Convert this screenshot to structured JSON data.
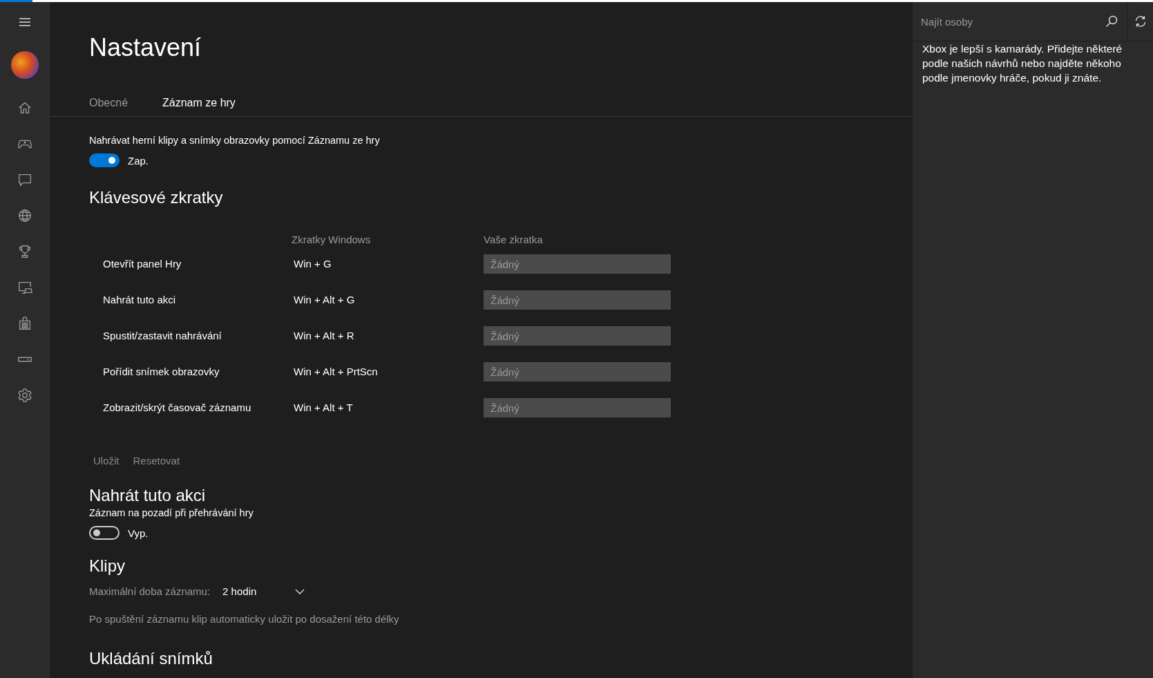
{
  "sidebar": {
    "items": [
      {
        "kind": "menu"
      },
      {
        "kind": "avatar"
      },
      {
        "kind": "home"
      },
      {
        "kind": "controller"
      },
      {
        "kind": "chat"
      },
      {
        "kind": "globe"
      },
      {
        "kind": "trophy"
      },
      {
        "kind": "screen"
      },
      {
        "kind": "store"
      },
      {
        "kind": "device"
      },
      {
        "kind": "settings"
      }
    ]
  },
  "title": "Nastavení",
  "tabs": [
    {
      "label": "Obecné",
      "selected": false
    },
    {
      "label": "Záznam ze hry",
      "selected": true
    }
  ],
  "record_setting": {
    "label": "Nahrávat herní klipy a snímky obrazovky pomocí Záznamu ze hry",
    "on": true,
    "state_text": "Zap."
  },
  "shortcuts": {
    "heading": "Klávesové zkratky",
    "columns": [
      "Zkratky Windows",
      "Vaše zkratka"
    ],
    "rows": [
      {
        "action": "Otevřít panel Hry",
        "windows": "Win + G",
        "placeholder": "Žádný"
      },
      {
        "action": "Nahrát tuto akci",
        "windows": "Win + Alt + G",
        "placeholder": "Žádný"
      },
      {
        "action": "Spustit/zastavit nahrávání",
        "windows": "Win + Alt + R",
        "placeholder": "Žádný"
      },
      {
        "action": "Pořídit snímek obrazovky",
        "windows": "Win + Alt + PrtScn",
        "placeholder": "Žádný"
      },
      {
        "action": "Zobrazit/skrýt časovač záznamu",
        "windows": "Win + Alt + T",
        "placeholder": "Žádný"
      }
    ],
    "buttons": [
      {
        "label": "Uložit",
        "disabled": true
      },
      {
        "label": "Resetovat",
        "disabled": true
      }
    ]
  },
  "background_recording": {
    "heading": "Nahrát tuto akci",
    "label": "Záznam na pozadí při přehrávání hry",
    "on": false,
    "state_text": "Vyp."
  },
  "clips": {
    "heading": "Klipy",
    "max_label": "Maximální doba záznamu:",
    "max_value": "2 hodin",
    "description": "Po spuštění záznamu klip automaticky uložit po dosažení této délky"
  },
  "screenshots": {
    "heading": "Ukládání snímků"
  },
  "people_panel": {
    "search_placeholder": "Najít osoby",
    "message": "Xbox je lepší s kamarády. Přidejte některé podle našich návrhů nebo najděte někoho podle jmenovky hráče, pokud ji znáte."
  }
}
